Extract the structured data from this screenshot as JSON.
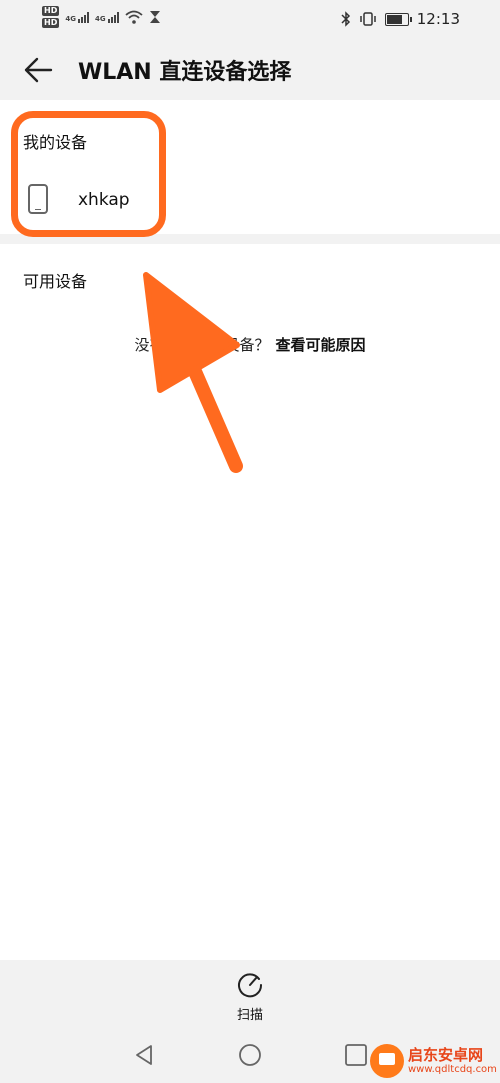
{
  "status_bar": {
    "time": "12:13",
    "sim1_badge": "HD",
    "sim2_badge": "HD",
    "network1": "4G",
    "network2": "4G"
  },
  "header": {
    "title": "WLAN 直连设备选择",
    "back_icon": "arrow-left-icon"
  },
  "my_devices": {
    "label": "我的设备",
    "device": {
      "name": "xhkap",
      "icon": "phone-icon"
    }
  },
  "available": {
    "label": "可用设备",
    "hint_text": "没有找到目标设备？",
    "hint_link": "查看可能原因"
  },
  "toolbar": {
    "scan_label": "扫描",
    "scan_icon": "refresh-icon"
  },
  "nav": {
    "back_icon": "triangle-back-icon",
    "home_icon": "circle-home-icon",
    "recents_icon": "square-recents-icon"
  },
  "annotation": {
    "color": "#ff6a1f"
  },
  "watermark": {
    "text": "启东安卓网",
    "url": "www.qdltcdq.com"
  }
}
